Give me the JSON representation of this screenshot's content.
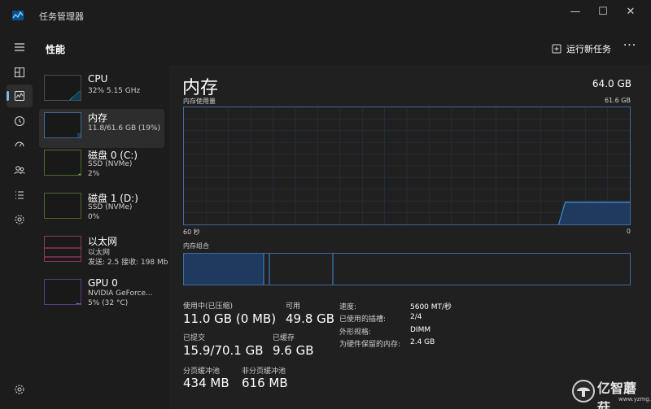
{
  "window": {
    "title": "任务管理器"
  },
  "header": {
    "title": "性能",
    "run_task_label": "运行新任务",
    "more_label": "···"
  },
  "window_controls": {
    "minimize": "—",
    "maximize": "☐",
    "close": "✕"
  },
  "devices": [
    {
      "name": "CPU",
      "line1": "32% 5.15 GHz",
      "line2": ""
    },
    {
      "name": "内存",
      "line1": "11.8/61.6 GB (19%)",
      "line2": ""
    },
    {
      "name": "磁盘 0 (C:)",
      "line1": "SSD (NVMe)",
      "line2": "2%"
    },
    {
      "name": "磁盘 1 (D:)",
      "line1": "SSD (NVMe)",
      "line2": "0%"
    },
    {
      "name": "以太网",
      "line1": "以太网",
      "line2": "发送: 2.5 接收: 198 Mb"
    },
    {
      "name": "GPU 0",
      "line1": "NVIDIA GeForce...",
      "line2": "5% (32 °C)"
    }
  ],
  "memory": {
    "title": "内存",
    "total": "64.0 GB",
    "usage_label": "内存使用量",
    "usage_max": "61.6 GB",
    "axis_left": "60 秒",
    "axis_right": "0",
    "composition_label": "内存组合",
    "graph_series_fraction_used": [
      0.19,
      0.19,
      0.19,
      0.19,
      0.19,
      0.19,
      0.19,
      0.19,
      0.19
    ]
  },
  "stats": {
    "in_use_label": "使用中(已压缩)",
    "in_use_value": "11.0 GB (0 MB)",
    "available_label": "可用",
    "available_value": "49.8 GB",
    "committed_label": "已提交",
    "committed_value": "15.9/70.1 GB",
    "cached_label": "已缓存",
    "cached_value": "9.6 GB",
    "paged_label": "分页缓冲池",
    "paged_value": "434 MB",
    "nonpaged_label": "非分页缓冲池",
    "nonpaged_value": "616 MB"
  },
  "specs": [
    {
      "key": "速度:",
      "value": "5600 MT/秒"
    },
    {
      "key": "已使用的插槽:",
      "value": "2/4"
    },
    {
      "key": "外形规格:",
      "value": "DIMM"
    },
    {
      "key": "为硬件保留的内存:",
      "value": "2.4 GB"
    }
  ],
  "watermark": {
    "text": "亿智蘑菇",
    "url": "www.yzmg.com"
  },
  "colors": {
    "accent": "#76b9ed",
    "memory_line": "#3f8fd8",
    "memory_fill": "#1f3a5e",
    "graph_border": "#3f6a99"
  },
  "icons": [
    "app-icon",
    "hamburger-icon",
    "processes-icon",
    "performance-icon",
    "history-icon",
    "startup-icon",
    "users-icon",
    "details-icon",
    "services-icon",
    "settings-icon",
    "run-task-icon"
  ]
}
